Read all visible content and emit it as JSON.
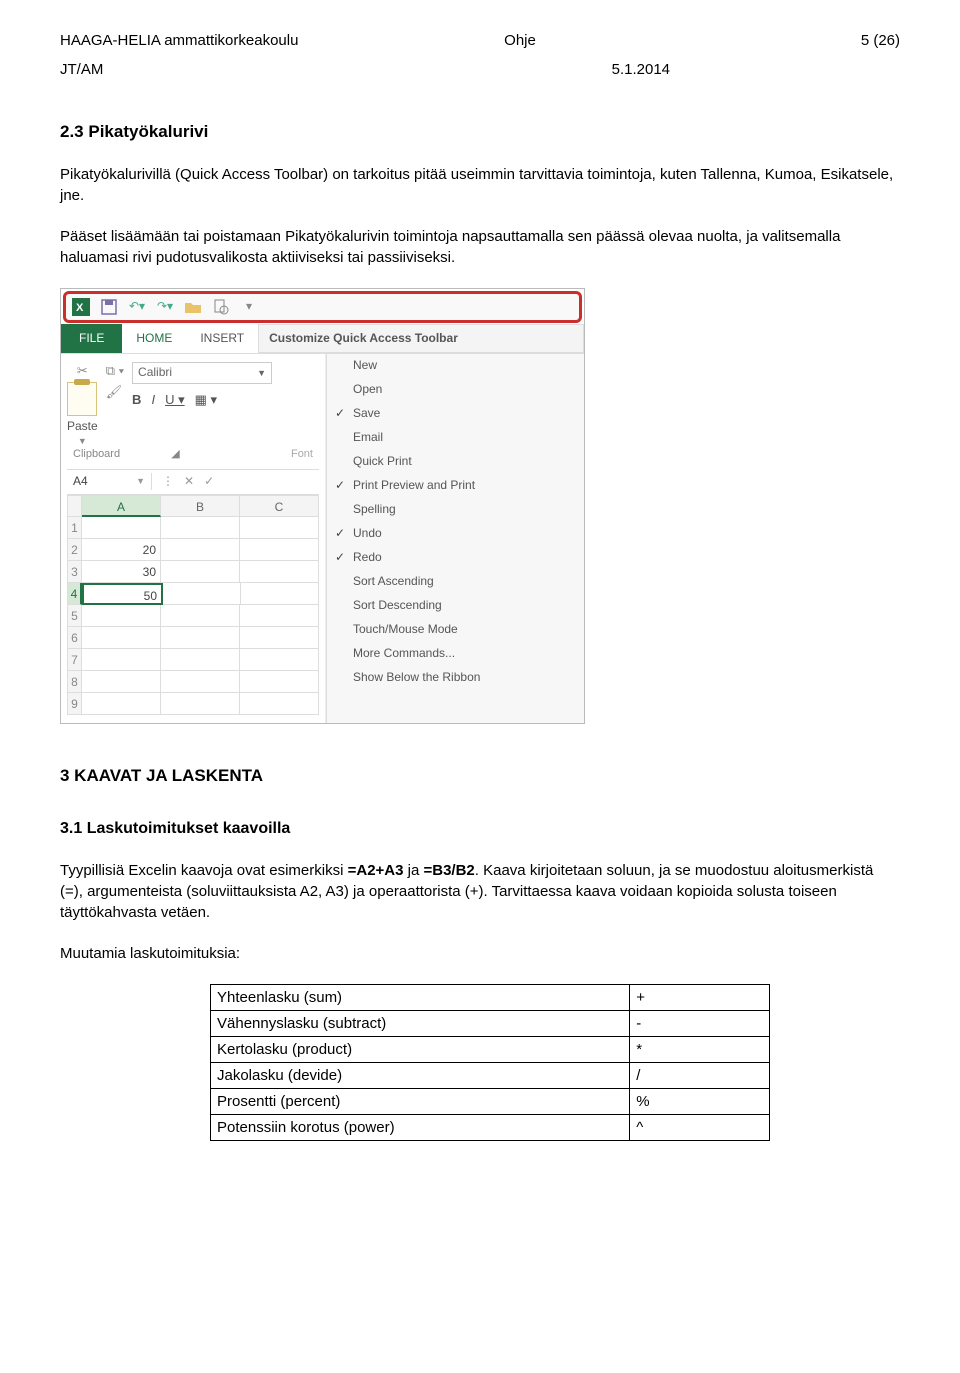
{
  "header": {
    "left": "HAAGA-HELIA ammattikorkeakoulu",
    "mid": "Ohje",
    "right": "5 (26)"
  },
  "subhead": {
    "left": "JT/AM",
    "right": "5.1.2014"
  },
  "section23": {
    "title": "2.3   Pikatyökalurivi",
    "para1": "Pikatyökalurivillä (Quick Access Toolbar) on tarkoitus pitää useimmin tarvittavia toimintoja, kuten Tallenna, Kumoa, Esikatsele, jne.",
    "para2": "Pääset lisäämään tai poistamaan Pikatyökalurivin toimintoja napsauttamalla sen päässä olevaa nuolta, ja valitsemalla haluamasi rivi pudotusvalikosta aktiiviseksi tai passiiviseksi."
  },
  "excel": {
    "tab_file": "FILE",
    "tab_home": "HOME",
    "tab_insert": "INSERT",
    "customize_title": "Customize Quick Access Toolbar",
    "font_name": "Calibri",
    "paste_label": "Paste",
    "clipboard_label": "Clipboard",
    "font_label": "Font",
    "bold": "B",
    "italic": "I",
    "underline": "U",
    "namebox": "A4",
    "cols": [
      "A",
      "B",
      "C"
    ],
    "rows": [
      "1",
      "2",
      "3",
      "4",
      "5",
      "6",
      "7",
      "8",
      "9"
    ],
    "data": {
      "r2a": "20",
      "r3a": "30",
      "r4a": "50"
    },
    "menu": [
      {
        "label": "New",
        "checked": false
      },
      {
        "label": "Open",
        "checked": false
      },
      {
        "label": "Save",
        "checked": true
      },
      {
        "label": "Email",
        "checked": false
      },
      {
        "label": "Quick Print",
        "checked": false
      },
      {
        "label": "Print Preview and Print",
        "checked": true
      },
      {
        "label": "Spelling",
        "checked": false
      },
      {
        "label": "Undo",
        "checked": true
      },
      {
        "label": "Redo",
        "checked": true
      },
      {
        "label": "Sort Ascending",
        "checked": false
      },
      {
        "label": "Sort Descending",
        "checked": false
      },
      {
        "label": "Touch/Mouse Mode",
        "checked": false
      },
      {
        "label": "More Commands...",
        "checked": false
      },
      {
        "label": "Show Below the Ribbon",
        "checked": false
      }
    ]
  },
  "section3": {
    "title": "3    KAAVAT JA LASKENTA",
    "sub_title": "3.1   Laskutoimitukset kaavoilla",
    "para1a": "Tyypillisiä Excelin kaavoja ovat esimerkiksi ",
    "para1b": "=A2+A3",
    "para1c": " ja ",
    "para1d": "=B3/B2",
    "para1e": ". Kaava kirjoitetaan soluun, ja se muodostuu aloitusmerkistä (=), argumenteista (soluviittauksista A2, A3) ja operaattorista (+). Tarvittaessa kaava voidaan kopioida solusta toiseen täyttökahvasta vetäen.",
    "para2": "Muutamia laskutoimituksia:",
    "ops": [
      {
        "name": "Yhteenlasku (sum)",
        "sym": "+"
      },
      {
        "name": "Vähennyslasku (subtract)",
        "sym": "-"
      },
      {
        "name": "Kertolasku (product)",
        "sym": "*"
      },
      {
        "name": "Jakolasku (devide)",
        "sym": "/"
      },
      {
        "name": "Prosentti (percent)",
        "sym": "%"
      },
      {
        "name": "Potenssiin korotus (power)",
        "sym": "^"
      }
    ]
  }
}
